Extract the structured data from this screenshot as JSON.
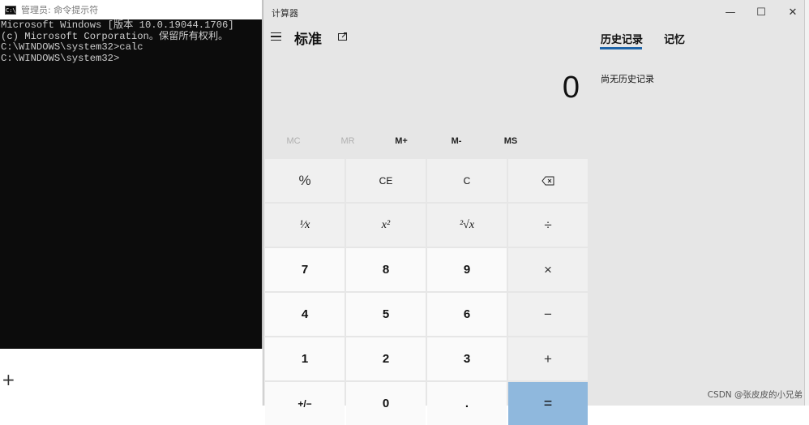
{
  "cmd": {
    "title": "管理员: 命令提示符",
    "lines": [
      "Microsoft Windows [版本 10.0.19044.1706]",
      "(c) Microsoft Corporation。保留所有权利。",
      "",
      "C:\\WINDOWS\\system32>calc",
      "",
      "C:\\WINDOWS\\system32>"
    ]
  },
  "calc": {
    "title": "计算器",
    "mode": "标准",
    "display": "0",
    "window_buttons": {
      "minimize": "—",
      "maximize": "☐",
      "close": "✕"
    },
    "memory": [
      "MC",
      "MR",
      "M+",
      "M-",
      "MS"
    ],
    "keys": [
      "%",
      "CE",
      "C",
      "⌫",
      "¹⁄x",
      "x²",
      "²√x",
      "÷",
      "7",
      "8",
      "9",
      "×",
      "4",
      "5",
      "6",
      "−",
      "1",
      "2",
      "3",
      "+",
      "+/−",
      "0",
      ".",
      "="
    ],
    "tabs": {
      "history": "历史记录",
      "memory": "记忆"
    },
    "history_empty": "尚无历史记录"
  },
  "background": {
    "plus": "+"
  },
  "watermark": "CSDN @张皮皮的小兄弟"
}
